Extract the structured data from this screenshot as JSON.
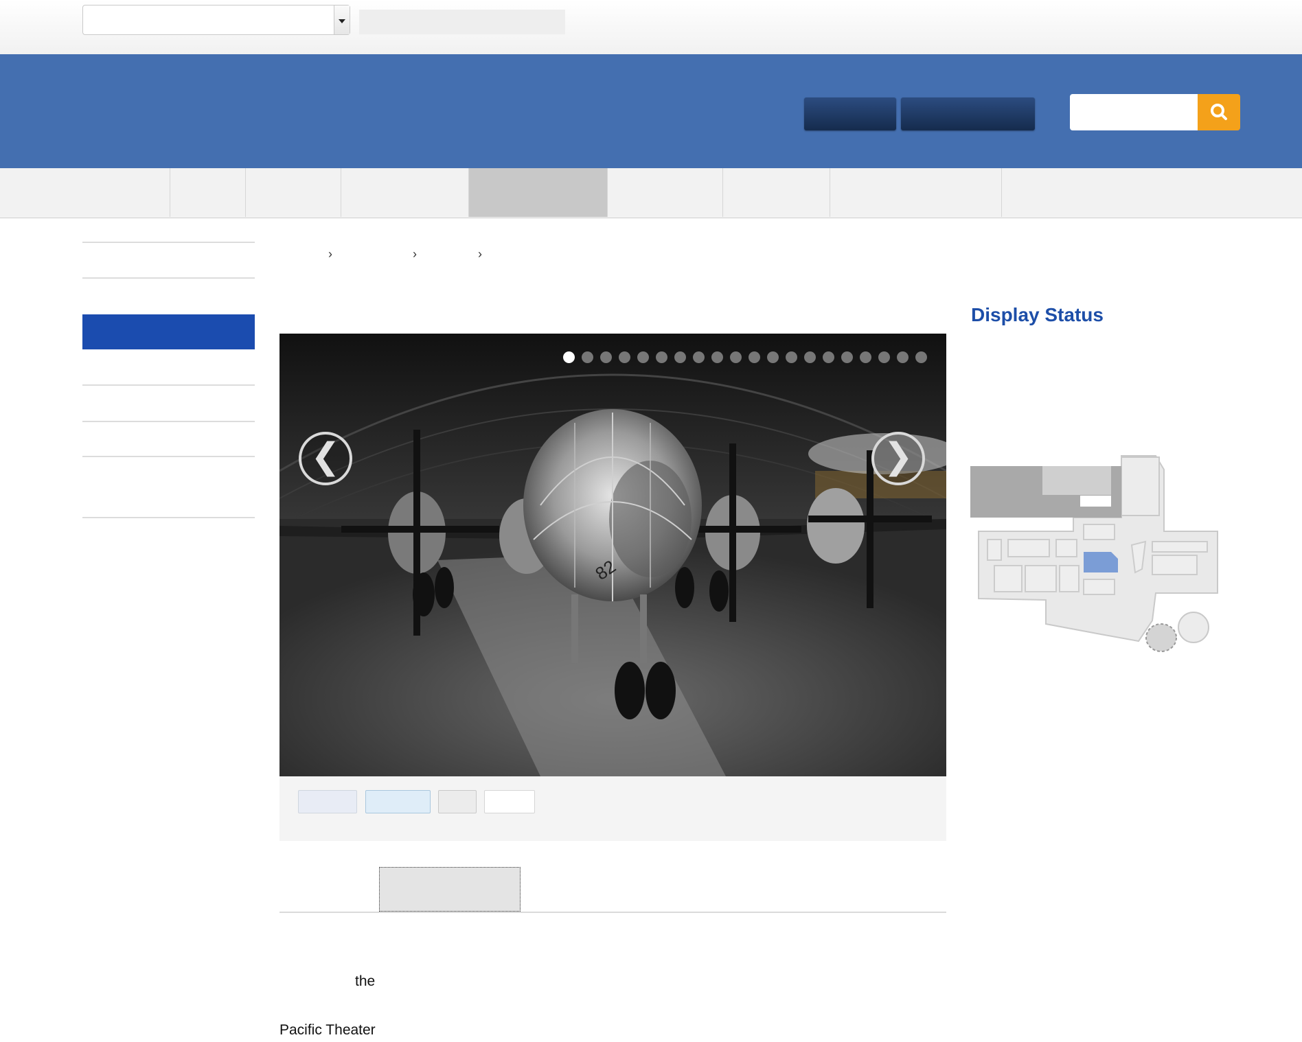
{
  "top": {
    "language_select_value": "",
    "top_field_text": ""
  },
  "header": {
    "buttons": [
      "",
      ""
    ],
    "search": {
      "placeholder": "",
      "button_icon": "search-icon",
      "accent_color": "#f4a11a"
    },
    "background_color": "#446fb0"
  },
  "nav": {
    "active_index": 4,
    "tabs": [
      "",
      "",
      "",
      "",
      "",
      "",
      "",
      "",
      ""
    ]
  },
  "sidebar": {
    "active_index": 2,
    "active_color": "#1b4caf"
  },
  "breadcrumb": {
    "separators": [
      "›",
      "›",
      "›"
    ]
  },
  "slideshow": {
    "dot_count": 20,
    "active_dot": 1,
    "prev_glyph": "❮",
    "next_glyph": "❯",
    "image_subject": "B-29 Superfortress bomber displayed in museum hangar",
    "tail_marking": "82"
  },
  "content": {
    "word_the": "the",
    "pacific_theater": "Pacific Theater"
  },
  "right_column": {
    "display_status_heading": "Display Status",
    "map_highlight_color": "#7b9dd6"
  }
}
